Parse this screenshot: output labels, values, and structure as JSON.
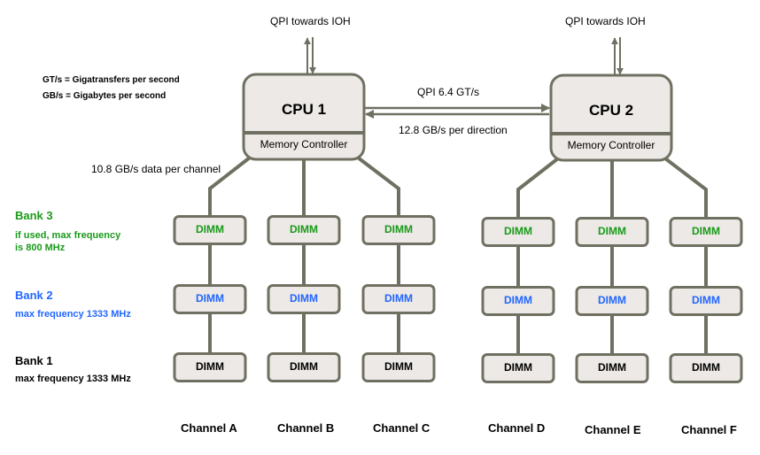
{
  "colors": {
    "line": "#707062",
    "box_fill": "#ece9e6",
    "bank3": "#1a9a1a",
    "bank2": "#2266ff",
    "bank1": "#000000"
  },
  "legend": {
    "gt": "GT/s = Gigatransfers per second",
    "gb": "GB/s = Gigabytes per second"
  },
  "cpus": [
    {
      "title": "CPU 1",
      "controller": "Memory Controller",
      "ioh_label": "QPI towards IOH"
    },
    {
      "title": "CPU 2",
      "controller": "Memory Controller",
      "ioh_label": "QPI towards IOH"
    }
  ],
  "qpi_link": {
    "speed": "QPI 6.4 GT/s",
    "bandwidth": "12.8 GB/s per direction"
  },
  "channel_bandwidth": "10.8 GB/s data per channel",
  "banks": [
    {
      "title": "Bank 3",
      "desc_line1": "if used, max frequency",
      "desc_line2": "is 800 MHz",
      "color_key": "bank3"
    },
    {
      "title": "Bank 2",
      "desc_line1": "max frequency 1333 MHz",
      "desc_line2": "",
      "color_key": "bank2"
    },
    {
      "title": "Bank 1",
      "desc_line1": "max frequency 1333 MHz",
      "desc_line2": "",
      "color_key": "bank1"
    }
  ],
  "dimm_label": "DIMM",
  "channels": [
    "Channel A",
    "Channel B",
    "Channel C",
    "Channel D",
    "Channel E",
    "Channel F"
  ]
}
